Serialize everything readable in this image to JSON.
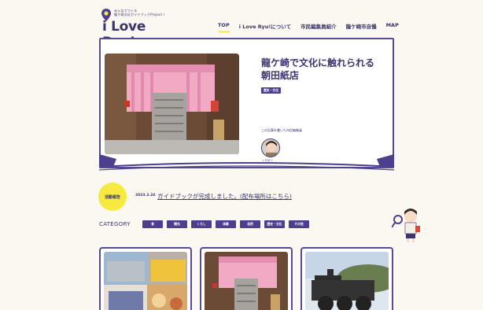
{
  "header": {
    "logo_sub_line1": "みんなでつくる",
    "logo_sub_line2": "龍ケ崎文化ガイドブックProject /",
    "logo_text": "i Love Ryu!",
    "nav": [
      {
        "label": "TOP",
        "active": true
      },
      {
        "label": "i Love Ryu!について",
        "active": false
      },
      {
        "label": "市民編集員紹介",
        "active": false
      },
      {
        "label": "龍ケ崎市自慢",
        "active": false
      },
      {
        "label": "MAP",
        "active": false
      }
    ]
  },
  "hero": {
    "title_line1": "龍ケ崎で文化に触れられる",
    "title_line2": "朝田紙店",
    "tag": "歴史・文化",
    "author_label": "この記事を書いた市民編集員",
    "author_name": "シロガツ"
  },
  "news": {
    "badge": "活動報告",
    "date": "2023.3.24",
    "link": "ガイドブックが完成しました。(配布場所はこちら)"
  },
  "category": {
    "label": "CATEGORY",
    "items": [
      "食",
      "観光",
      "くらし",
      "体験",
      "自然",
      "歴史・文化",
      "その他"
    ]
  },
  "colors": {
    "brand": "#4d3f8e",
    "accent_yellow": "#f6e93f",
    "background": "#fbf7f1"
  }
}
